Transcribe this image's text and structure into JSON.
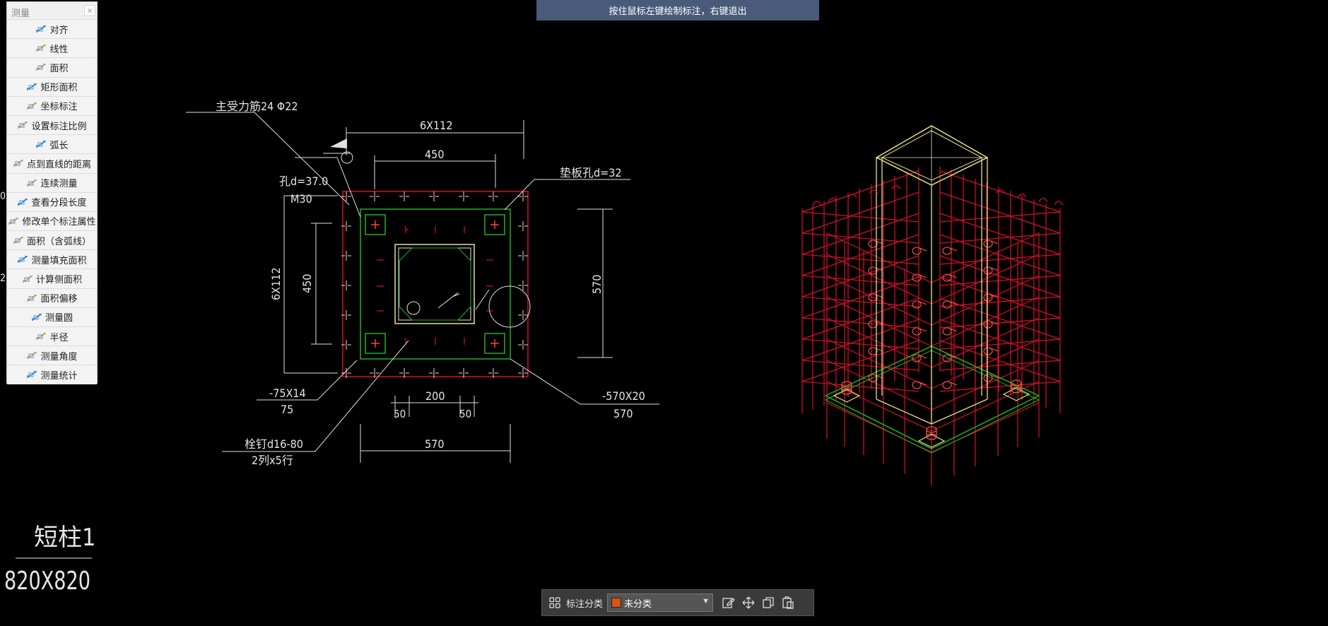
{
  "panel": {
    "title": "测量",
    "close_symbol": "×",
    "tools": [
      {
        "label": "对齐",
        "icon": "align-measure-icon"
      },
      {
        "label": "线性",
        "icon": "linear-measure-icon"
      },
      {
        "label": "面积",
        "icon": "area-measure-icon"
      },
      {
        "label": "矩形面积",
        "icon": "rect-area-icon"
      },
      {
        "label": "坐标标注",
        "icon": "coordinate-icon"
      },
      {
        "label": "设置标注比例",
        "icon": "scale-setting-icon"
      },
      {
        "label": "弧长",
        "icon": "arc-length-icon"
      },
      {
        "label": "点到直线的距离",
        "icon": "point-line-distance-icon"
      },
      {
        "label": "连续测量",
        "icon": "continuous-measure-icon"
      },
      {
        "label": "查看分段长度",
        "icon": "segment-length-icon"
      },
      {
        "label": "修改单个标注属性",
        "icon": "edit-annotation-icon"
      },
      {
        "label": "面积（含弧线）",
        "icon": "arc-area-icon"
      },
      {
        "label": "测量填充面积",
        "icon": "fill-area-icon"
      },
      {
        "label": "计算侧面积",
        "icon": "side-area-icon"
      },
      {
        "label": "面积偏移",
        "icon": "area-offset-icon"
      },
      {
        "label": "测量圆",
        "icon": "circle-measure-icon"
      },
      {
        "label": "半径",
        "icon": "radius-icon"
      },
      {
        "label": "测量角度",
        "icon": "angle-measure-icon"
      },
      {
        "label": "测量统计",
        "icon": "statistics-icon"
      }
    ]
  },
  "hint": {
    "text": "按住鼠标左键绘制标注，右键退出"
  },
  "bottom_bar": {
    "category_label": "标注分类",
    "selected_category": "未分类",
    "swatch_color": "#e05010"
  },
  "drawing": {
    "title_name": "短柱1",
    "title_size": "820X820",
    "labels": {
      "main_rebar": "主受力筋24 Φ22",
      "hole": "孔d=37.0",
      "bolt": "M30",
      "pad_hole": "垫板孔d=32",
      "top_dim_outer": "6X112",
      "top_dim_inner": "450",
      "left_dim_outer": "6X112",
      "left_dim_inner": "450",
      "right_dim": "570",
      "plate_left": "-75X14",
      "plate_left_sub": "75",
      "plate_right": "-570X20",
      "plate_right_sub": "570",
      "dim_50_left": "50",
      "dim_200": "200",
      "dim_50_right": "50",
      "stud": "栓钉d16-80",
      "stud_sub": "2列x5行",
      "bottom_dim": "570",
      "left_edge_a": "0",
      "left_edge_b": "2"
    }
  }
}
